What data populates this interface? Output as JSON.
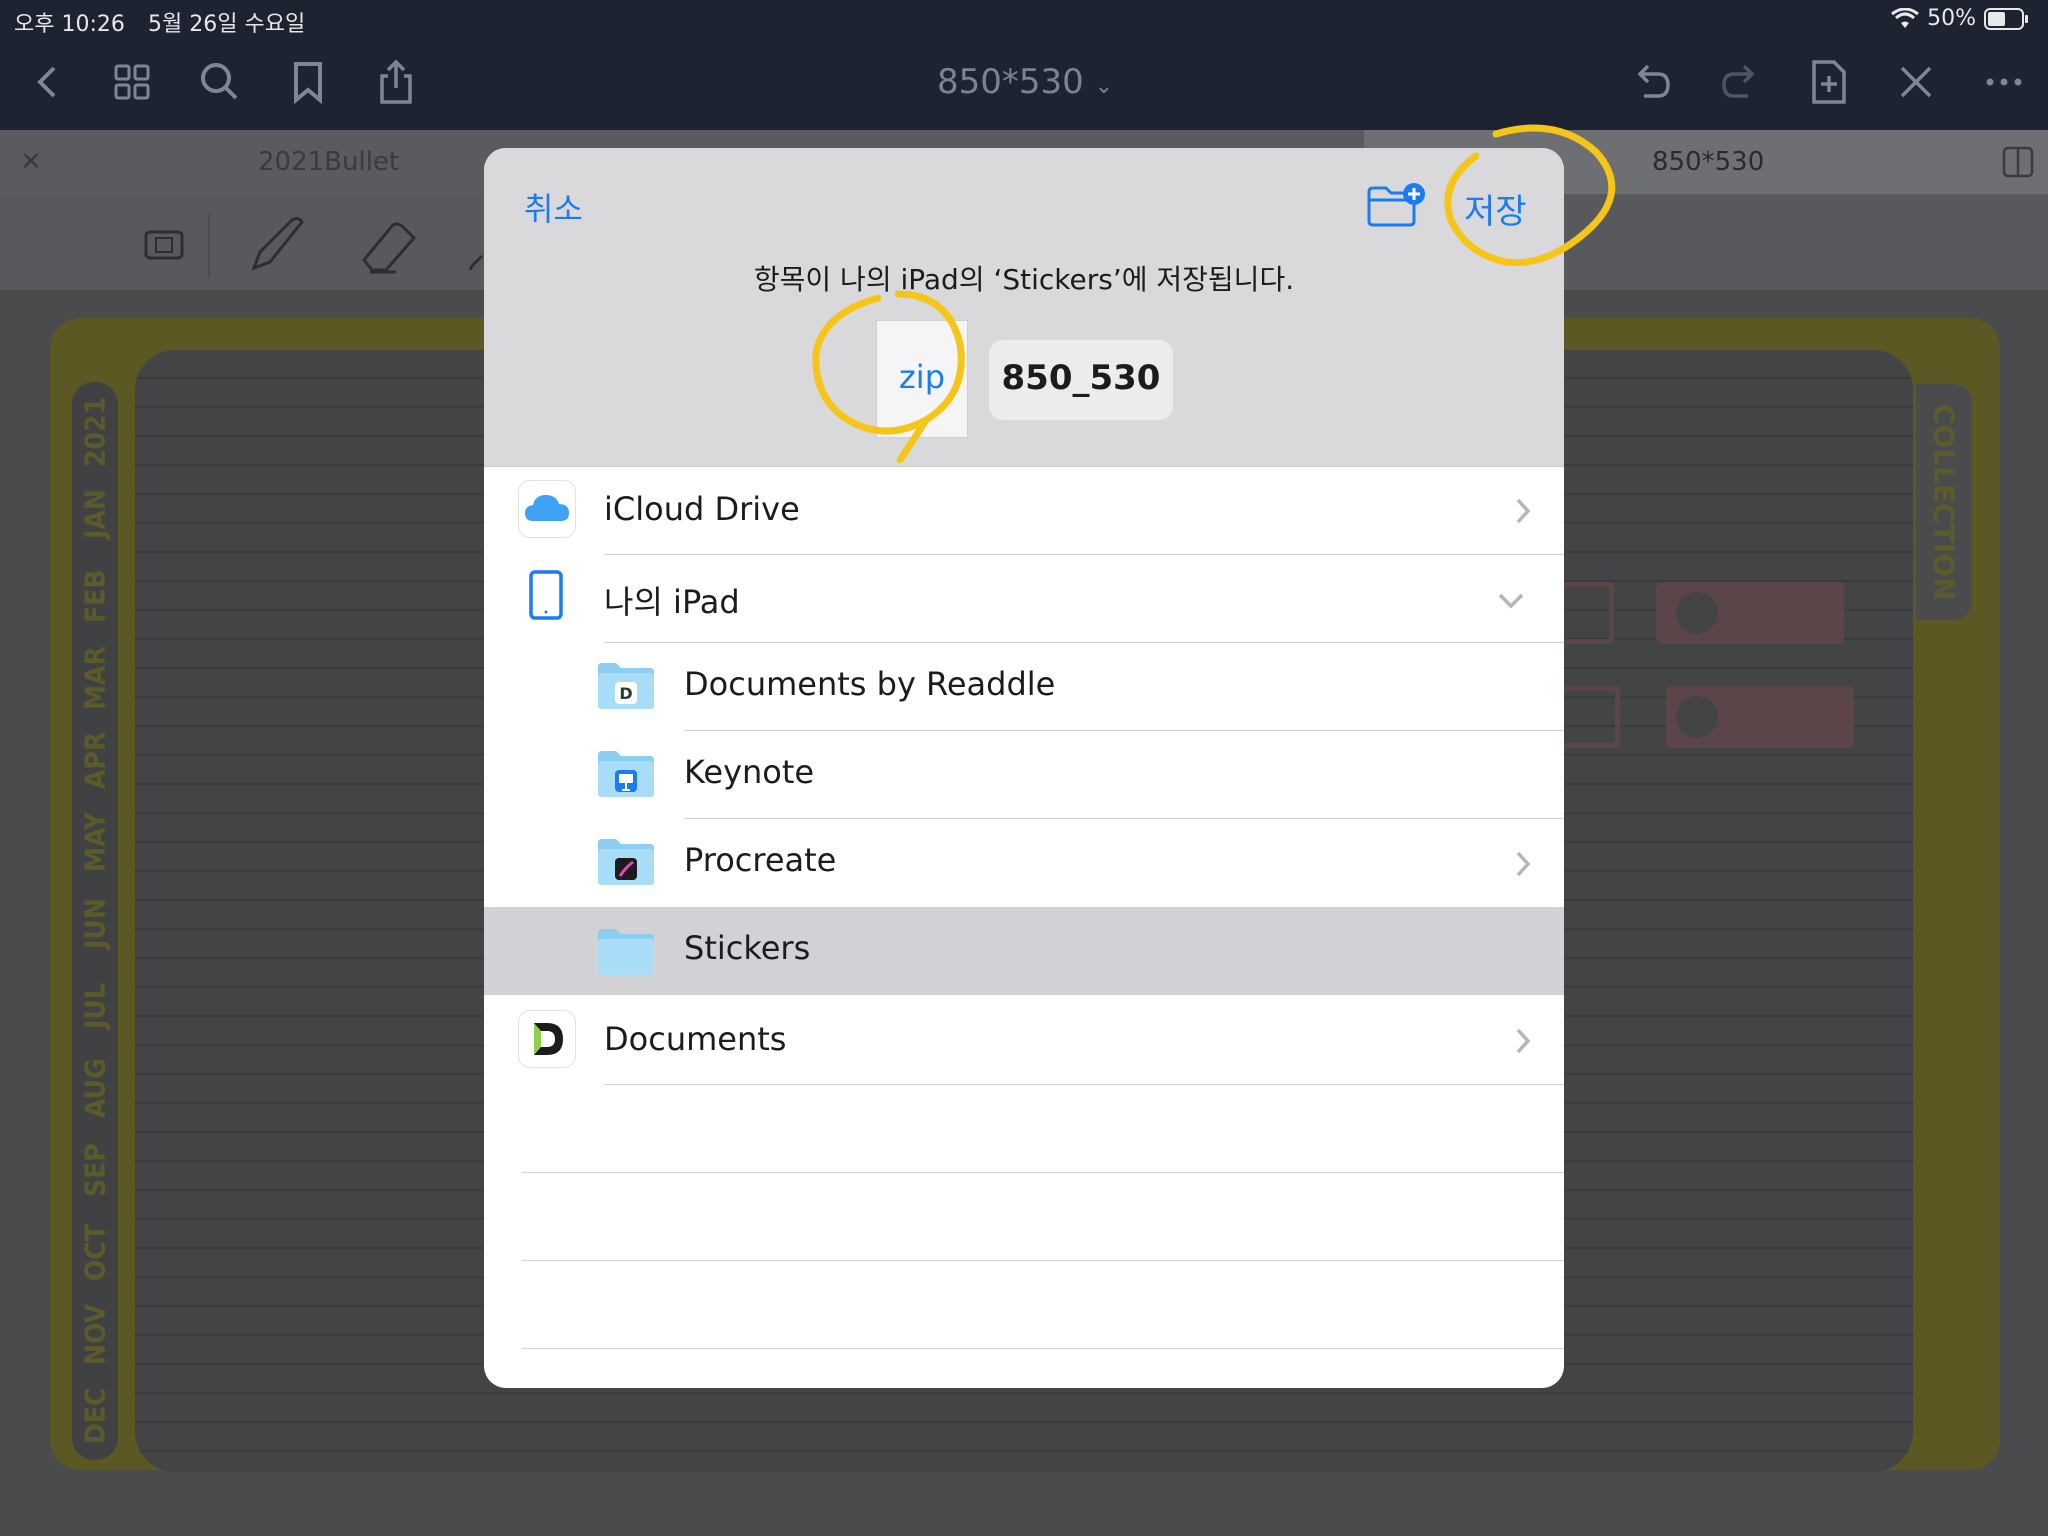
{
  "status": {
    "time": "오후 10:26",
    "date": "5월 26일 수요일",
    "battery": "50%"
  },
  "nav": {
    "title": "850*530"
  },
  "tabs": {
    "left_label": "2021Bullet",
    "right_label": "850*530"
  },
  "notebook": {
    "months": [
      "2021",
      "JAN",
      "FEB",
      "MAR",
      "APR",
      "MAY",
      "JUN",
      "JUL",
      "AUG",
      "SEP",
      "OCT",
      "NOV",
      "DEC"
    ],
    "collection_label": "COLLECTION"
  },
  "dialog": {
    "cancel_label": "취소",
    "save_label": "저장",
    "message": "항목이 나의 iPad의 ‘Stickers’에 저장됩니다.",
    "file_ext": "zip",
    "file_name": "850_530",
    "locations": [
      {
        "label": "iCloud Drive",
        "icon": "icloud-icon"
      },
      {
        "label": "나의 iPad",
        "icon": "ipad-icon"
      },
      {
        "label": "Documents by Readdle",
        "icon": "folder-readdle-icon"
      },
      {
        "label": "Keynote",
        "icon": "folder-keynote-icon"
      },
      {
        "label": "Procreate",
        "icon": "folder-procreate-icon"
      },
      {
        "label": "Stickers",
        "icon": "folder-icon",
        "selected": true
      },
      {
        "label": "Documents",
        "icon": "documents-app-icon"
      }
    ]
  },
  "colors": {
    "accent": "#1a7cf0",
    "annotation": "#f5c518"
  }
}
